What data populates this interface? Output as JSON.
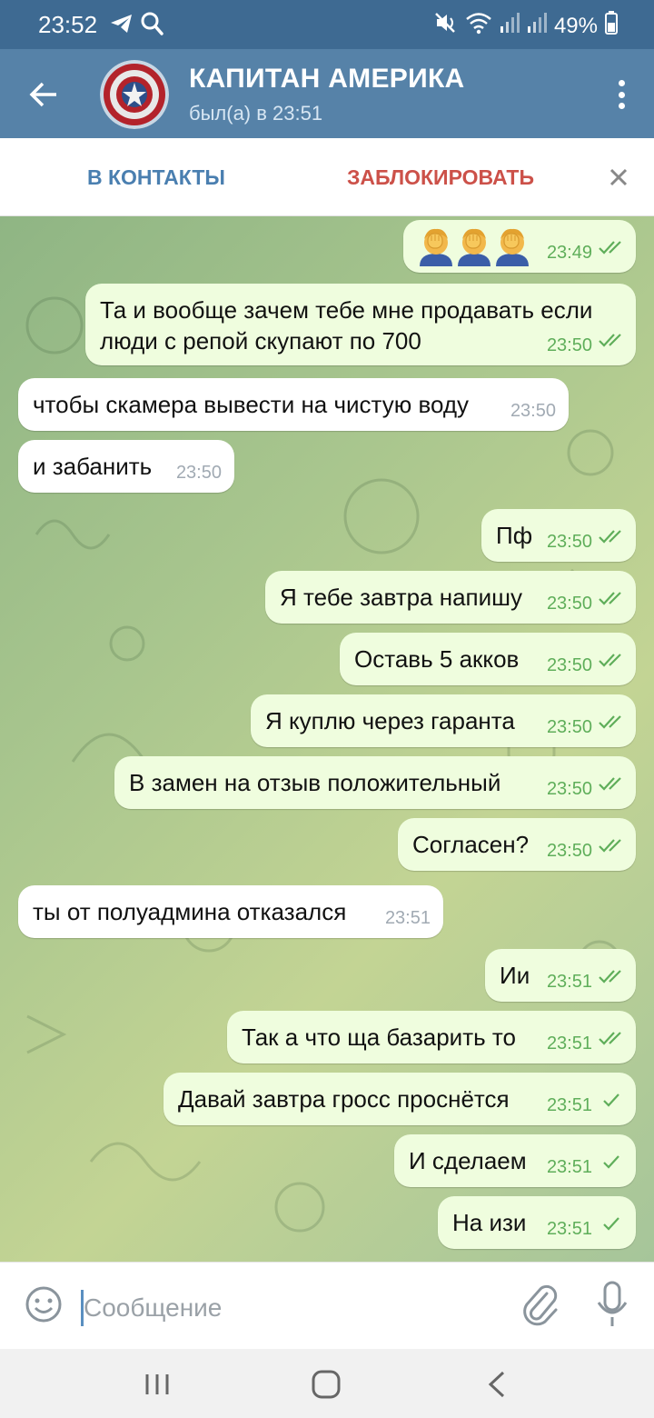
{
  "status_bar": {
    "time": "23:52",
    "battery": "49%"
  },
  "header": {
    "title": "КАПИТАН АМЕРИКА",
    "status": "был(а) в 23:51"
  },
  "actions": {
    "add_contact": "В КОНТАКТЫ",
    "block": "ЗАБЛОКИРОВАТЬ"
  },
  "messages": [
    {
      "dir": "out",
      "text": "",
      "time": "23:49",
      "read": "double",
      "emoji": "facepalm x3"
    },
    {
      "dir": "out",
      "text": "Та и вообще зачем тебе мне продавать если",
      "text2": "люди с репой скупают по 700",
      "time": "23:50",
      "read": "double"
    },
    {
      "dir": "in",
      "text": "чтобы скамера вывести на чистую воду",
      "time": "23:50"
    },
    {
      "dir": "in",
      "text": "и забанить",
      "time": "23:50"
    },
    {
      "dir": "out",
      "text": "Пф",
      "time": "23:50",
      "read": "double"
    },
    {
      "dir": "out",
      "text": "Я тебе завтра напишу",
      "time": "23:50",
      "read": "double"
    },
    {
      "dir": "out",
      "text": "Оставь 5 акков",
      "time": "23:50",
      "read": "double"
    },
    {
      "dir": "out",
      "text": "Я куплю через гаранта",
      "time": "23:50",
      "read": "double"
    },
    {
      "dir": "out",
      "text": "В замен на отзыв положительный",
      "time": "23:50",
      "read": "double"
    },
    {
      "dir": "out",
      "text": "Согласен?",
      "time": "23:50",
      "read": "double"
    },
    {
      "dir": "in",
      "text": "ты от полуадмина отказался",
      "time": "23:51"
    },
    {
      "dir": "out",
      "text": "Ии",
      "time": "23:51",
      "read": "double"
    },
    {
      "dir": "out",
      "text": "Так а что ща базарить то",
      "time": "23:51",
      "read": "double"
    },
    {
      "dir": "out",
      "text": "Давай завтра гросс проснётся",
      "time": "23:51",
      "read": "single"
    },
    {
      "dir": "out",
      "text": "И сделаем",
      "time": "23:51",
      "read": "single"
    },
    {
      "dir": "out",
      "text": "На изи",
      "time": "23:51",
      "read": "single"
    }
  ],
  "input": {
    "placeholder": "Сообщение"
  },
  "colors": {
    "header": "#5682a8",
    "status_bar": "#3e6a92",
    "outgoing_bubble": "#effdde",
    "incoming_bubble": "#ffffff",
    "read_check": "#5fae5a",
    "add_contact": "#4a7fb0",
    "block": "#cc5149"
  },
  "icons": [
    "back-arrow-icon",
    "more-vertical-icon",
    "close-icon",
    "emoji-icon",
    "paperclip-icon",
    "microphone-icon",
    "double-check-icon",
    "single-check-icon",
    "telegram-icon",
    "search-icon",
    "mute-icon",
    "wifi-icon",
    "signal-icon",
    "battery-icon",
    "nav-recent-icon",
    "nav-home-icon",
    "nav-back-icon"
  ]
}
